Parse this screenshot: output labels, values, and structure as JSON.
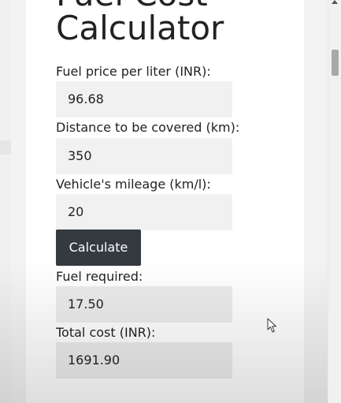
{
  "calculator": {
    "title_line_1": "Fuel Cost",
    "title_line_2": "Calculator",
    "fuel_price_label": "Fuel price per liter (INR):",
    "fuel_price_value": "96.68",
    "distance_label": "Distance to be covered (km):",
    "distance_value": "350",
    "mileage_label": "Vehicle's mileage (km/l):",
    "mileage_value": "20",
    "calculate_button": "Calculate",
    "fuel_required_label": "Fuel required:",
    "fuel_required_value": "17.50",
    "total_cost_label": "Total cost (INR):",
    "total_cost_value": "1691.90"
  },
  "colors": {
    "button_background": "#343a40",
    "button_text": "#ffffff",
    "field_background": "#f1f1f1",
    "page_background": "#ffffff"
  },
  "icons": {
    "cursor": "mouse-pointer-icon",
    "scroll_up": "scroll-up-arrow-icon"
  }
}
